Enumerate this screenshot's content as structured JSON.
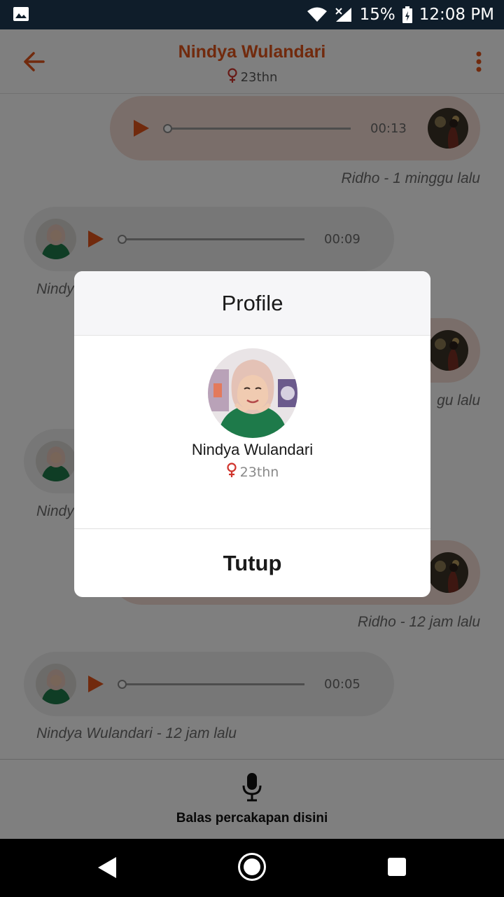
{
  "status_bar": {
    "battery": "15%",
    "time": "12:08 PM"
  },
  "app_bar": {
    "title": "Nindya Wulandari",
    "age": "23thn"
  },
  "messages": [
    {
      "sender": "Ridho",
      "duration": "00:13",
      "meta": "Ridho - 1 minggu lalu",
      "side": "sent"
    },
    {
      "sender": "Nindya Wulandari",
      "duration": "00:09",
      "meta": "Nindy",
      "side": "received"
    },
    {
      "sender": "Ridho",
      "duration": "",
      "meta": "gu lalu",
      "side": "sent"
    },
    {
      "sender": "Nindya Wulandari",
      "duration": "",
      "meta": "Nindy",
      "side": "received"
    },
    {
      "sender": "Ridho",
      "duration": "",
      "meta": "Ridho - 12 jam lalu",
      "side": "sent"
    },
    {
      "sender": "Nindya Wulandari",
      "duration": "00:05",
      "meta": "Nindya Wulandari - 12 jam lalu",
      "side": "received"
    }
  ],
  "reply_bar": {
    "label": "Balas percakapan disini"
  },
  "dialog": {
    "title": "Profile",
    "name": "Nindya Wulandari",
    "age": "23thn",
    "close_label": "Tutup"
  },
  "colors": {
    "accent": "#e2541a",
    "sent_bubble": "#f5ddd5",
    "received_bubble": "#eeeeee",
    "female_icon": "#d0342c"
  },
  "icons": {
    "status": [
      "image-icon",
      "wifi-icon",
      "signal-icon",
      "battery-icon"
    ],
    "app_bar": [
      "back-arrow-icon",
      "more-vert-icon",
      "female-icon"
    ],
    "reply": "microphone-icon",
    "nav": [
      "nav-back-icon",
      "nav-home-icon",
      "nav-recent-icon"
    ]
  }
}
